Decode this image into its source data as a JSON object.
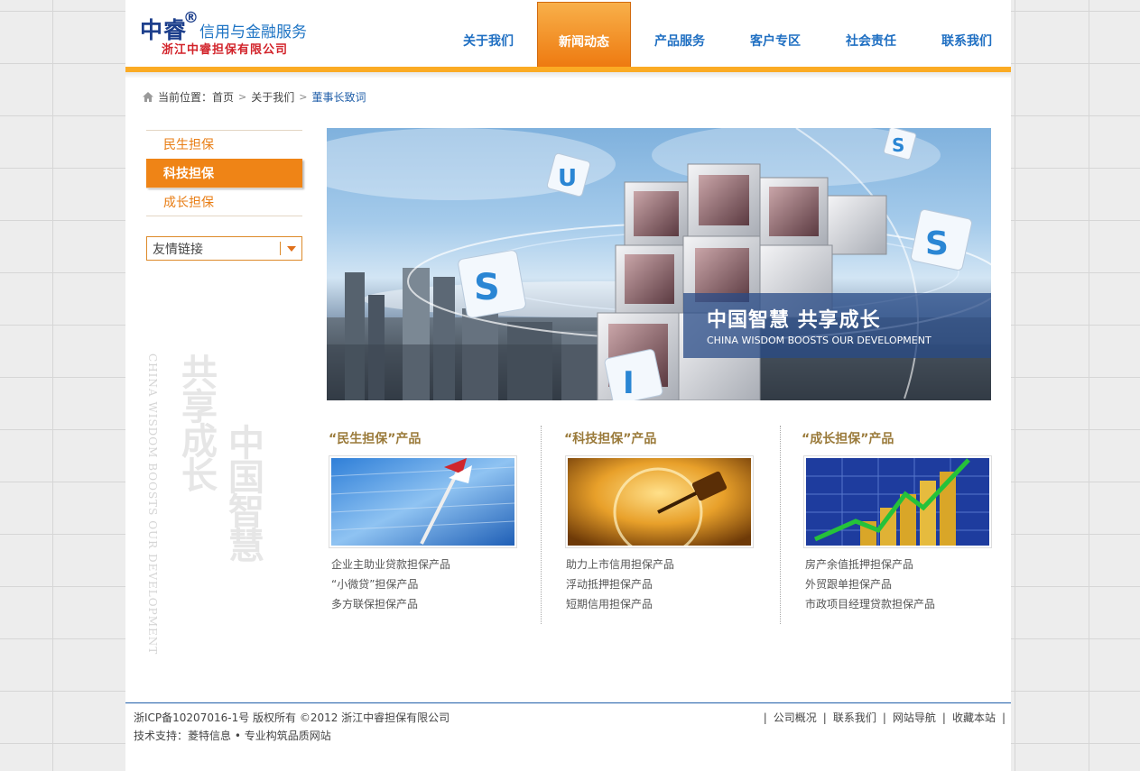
{
  "logo": {
    "main": "中睿",
    "reg": "®",
    "slogan": "信用与金融服务",
    "company": "浙江中睿担保有限公司"
  },
  "nav": [
    {
      "label": "关于我们",
      "active": false
    },
    {
      "label": "新闻动态",
      "active": true
    },
    {
      "label": "产品服务",
      "active": false
    },
    {
      "label": "客户专区",
      "active": false
    },
    {
      "label": "社会责任",
      "active": false
    },
    {
      "label": "联系我们",
      "active": false
    }
  ],
  "breadcrumb": {
    "prefix": "当前位置：",
    "items": [
      "首页",
      "关于我们"
    ],
    "current": "董事长致词"
  },
  "sidebar": {
    "items": [
      {
        "label": "民生担保",
        "active": false
      },
      {
        "label": "科技担保",
        "active": true
      },
      {
        "label": "成长担保",
        "active": false
      }
    ],
    "friend_links": "友情链接"
  },
  "watermark": {
    "en": "CHINA WISDOM BOOSTS OUR DEVELOPMENT",
    "cn_line1": "共享成长",
    "cn_line2": "中国智慧"
  },
  "banner": {
    "title_cn": "中国智慧 共享成长",
    "title_en": "CHINA WISDOM BOOSTS OUR DEVELOPMENT"
  },
  "products": [
    {
      "title": "“民生担保”产品",
      "items": [
        "企业主助业贷款担保产品",
        "“小微贷”担保产品",
        "多方联保担保产品"
      ]
    },
    {
      "title": "“科技担保”产品",
      "items": [
        "助力上市信用担保产品",
        "浮动抵押担保产品",
        "短期信用担保产品"
      ]
    },
    {
      "title": "“成长担保”产品",
      "items": [
        "房产余值抵押担保产品",
        "外贸跟单担保产品",
        "市政项目经理贷款担保产品"
      ]
    }
  ],
  "footer": {
    "line1": "浙ICP备10207016-1号  版权所有  ©2012  浙江中睿担保有限公司",
    "line2": "技术支持：菱特信息 • 专业构筑品质网站",
    "links": [
      "公司概况",
      "联系我们",
      "网站导航",
      "收藏本站"
    ]
  },
  "colors": {
    "brand_blue": "#1f6fc2",
    "accent_orange": "#ef8416",
    "header_bar": "#fbab24"
  }
}
